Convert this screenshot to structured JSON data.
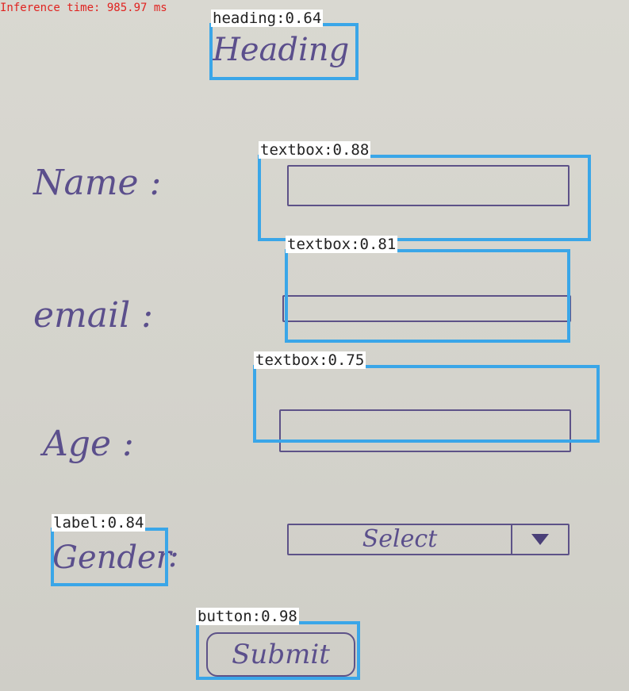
{
  "inference_label": "Inference time: 985.97 ms",
  "sketch": {
    "heading": "Heading",
    "name_label": "Name :",
    "email_label": "email :",
    "age_label": "Age :",
    "gender_label": "Gender",
    "gender_colon": ":",
    "select_text": "Select",
    "submit_text": "Submit"
  },
  "detections": [
    {
      "label": "heading:0.64"
    },
    {
      "label": "textbox:0.88"
    },
    {
      "label": "textbox:0.81"
    },
    {
      "label": "textbox:0.75"
    },
    {
      "label": "label:0.84"
    },
    {
      "label": "button:0.98"
    }
  ],
  "colors": {
    "detection_box": "#3aa6e8",
    "ink": "#5b4f8c",
    "inference_text": "#e0221f"
  }
}
